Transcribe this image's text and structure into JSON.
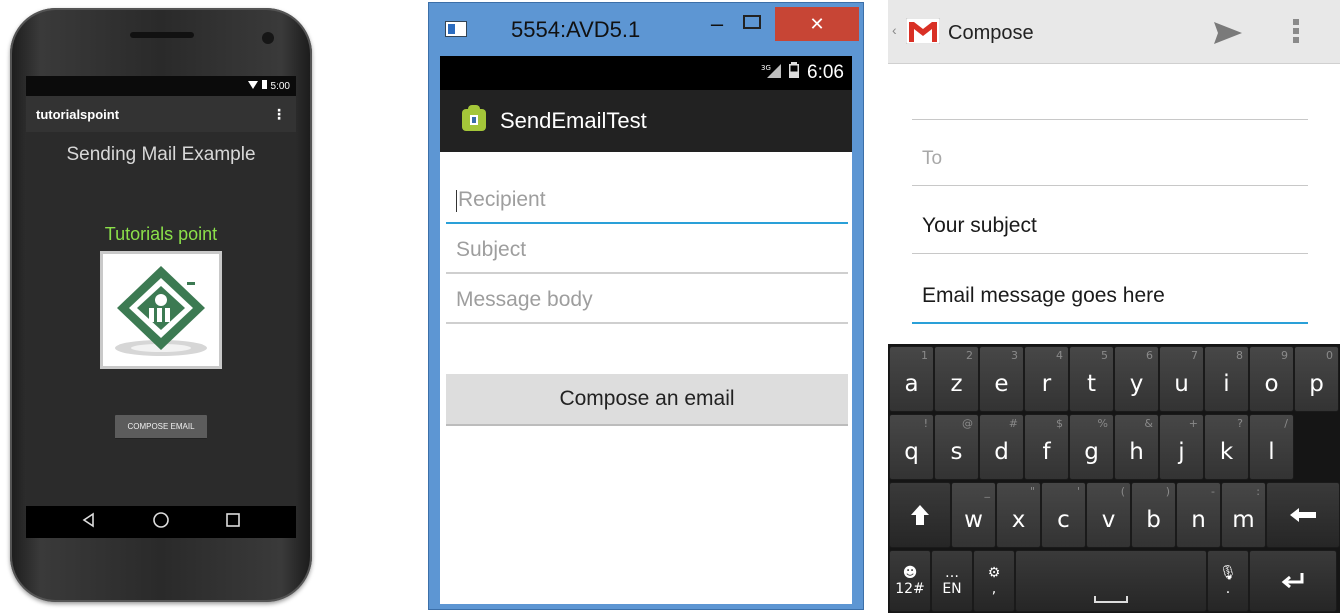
{
  "panel1": {
    "status_time": "5:00",
    "app_title": "tutorialspoint",
    "heading": "Sending Mail Example",
    "subheading": "Tutorials point",
    "button_label": "COMPOSE EMAIL",
    "colors": {
      "subheading": "#8be04a",
      "screen_bg": "#2b2b2b"
    }
  },
  "panel2": {
    "window_title": "5554:AVD5.1",
    "status_time": "6:06",
    "app_title": "SendEmailTest",
    "fields": [
      {
        "placeholder": "Recipient",
        "focused": true
      },
      {
        "placeholder": "Subject",
        "focused": false
      },
      {
        "placeholder": "Message body",
        "focused": false
      }
    ],
    "button_label": "Compose an email",
    "colors": {
      "window_frame": "#5d96d3",
      "close_button": "#c74535",
      "focus_line": "#2aa0d8"
    }
  },
  "panel3": {
    "title": "Compose",
    "to_hint": "To",
    "subject": "Your subject",
    "message": "Email message goes here",
    "keyboard": {
      "row1": [
        {
          "label": "a",
          "sub": "1"
        },
        {
          "label": "z",
          "sub": "2"
        },
        {
          "label": "e",
          "sub": "3"
        },
        {
          "label": "r",
          "sub": "4"
        },
        {
          "label": "t",
          "sub": "5"
        },
        {
          "label": "y",
          "sub": "6"
        },
        {
          "label": "u",
          "sub": "7"
        },
        {
          "label": "i",
          "sub": "8"
        },
        {
          "label": "o",
          "sub": "9"
        },
        {
          "label": "p",
          "sub": "0"
        }
      ],
      "row2": [
        {
          "label": "q",
          "sub": "!"
        },
        {
          "label": "s",
          "sub": "@"
        },
        {
          "label": "d",
          "sub": "#"
        },
        {
          "label": "f",
          "sub": "$"
        },
        {
          "label": "g",
          "sub": "%"
        },
        {
          "label": "h",
          "sub": "&"
        },
        {
          "label": "j",
          "sub": "+"
        },
        {
          "label": "k",
          "sub": "?"
        },
        {
          "label": "l",
          "sub": "/"
        }
      ],
      "row3": [
        {
          "label": "w",
          "sub": "_"
        },
        {
          "label": "x",
          "sub": "\""
        },
        {
          "label": "c",
          "sub": "'"
        },
        {
          "label": "v",
          "sub": "("
        },
        {
          "label": "b",
          "sub": ")"
        },
        {
          "label": "n",
          "sub": "-"
        },
        {
          "label": "m",
          "sub": ":"
        }
      ],
      "row4": {
        "symbols": "12#",
        "language": "EN",
        "comma": ",",
        "period": "."
      }
    },
    "colors": {
      "gmail_red": "#d93025",
      "focus_line": "#2aa0d8",
      "keyboard_bg": "#151515"
    }
  }
}
